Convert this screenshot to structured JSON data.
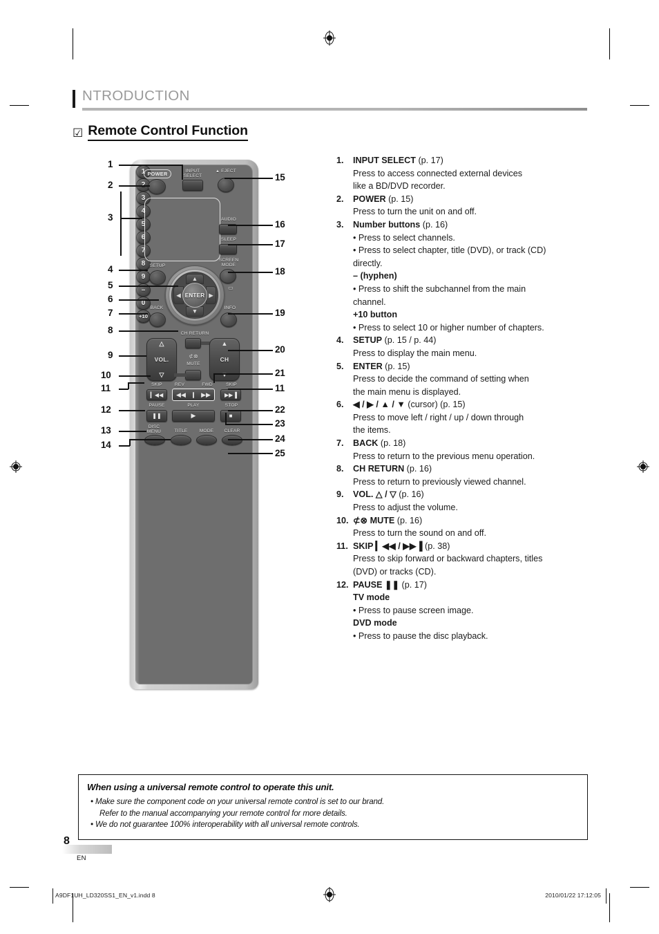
{
  "header": {
    "chapter": "NTRODUCTION",
    "section_title": "Remote Control Function",
    "checkbox_glyph": "☑"
  },
  "remote": {
    "labels": {
      "power": "POWER",
      "input_select_line1": "INPUT",
      "input_select_line2": "SELECT",
      "eject": "EJECT",
      "eject_glyph": "▲",
      "audio": "AUDIO",
      "sleep": "SLEEP",
      "screen_mode_line1": "SCREEN",
      "screen_mode_line2": "MODE",
      "setup": "SETUP",
      "enter": "ENTER",
      "back": "BACK",
      "info": "INFO",
      "ch_return": "CH RETURN",
      "vol": "VOL.",
      "mute": "MUTE",
      "mute_glyph": "⊄⊗",
      "ch": "CH",
      "skip_left": "SKIP",
      "skip_right": "SKIP",
      "rev": "REV",
      "fwd": "FWD",
      "play": "PLAY",
      "pause": "PAUSE",
      "stop": "STOP",
      "disc_menu_line1": "DISC",
      "disc_menu_line2": "MENU",
      "title": "TITLE",
      "mode": "MODE",
      "clear": "CLEAR"
    },
    "glyphs": {
      "up": "▲",
      "down": "▼",
      "left": "◀",
      "right": "▶",
      "vol_up": "△",
      "vol_down": "▽",
      "ch_up": "▲",
      "ch_down": "▼",
      "skip_prev": "▎◀◀",
      "skip_next": "▶▶▐",
      "rev": "◀◀",
      "fwd": "▶▶",
      "play": "▶",
      "pause": "❚❚",
      "stop": "■",
      "screen_mode_icon": "▭"
    },
    "keypad": [
      "1",
      "2",
      "3",
      "4",
      "5",
      "6",
      "7",
      "8",
      "9",
      "–",
      "0",
      "+10"
    ],
    "callouts_left": [
      "1",
      "2",
      "3",
      "4",
      "5",
      "6",
      "7",
      "8",
      "9",
      "10",
      "11",
      "12",
      "13",
      "14"
    ],
    "callouts_right": [
      "15",
      "16",
      "17",
      "18",
      "19",
      "20",
      "21",
      "11",
      "22",
      "23",
      "24",
      "25"
    ]
  },
  "functions": [
    {
      "num": "1.",
      "name": "INPUT SELECT",
      "page": "(p. 17)",
      "lines": [
        {
          "style": "plain",
          "text": "Press to access connected external devices"
        },
        {
          "style": "plain",
          "text": "like a BD/DVD recorder."
        }
      ]
    },
    {
      "num": "2.",
      "name": "POWER",
      "page": "(p. 15)",
      "lines": [
        {
          "style": "plain",
          "text": "Press to turn the unit on and off."
        }
      ]
    },
    {
      "num": "3.",
      "name": "Number buttons",
      "page": "(p. 16)",
      "lines": [
        {
          "style": "bullet",
          "text": "• Press to select channels."
        },
        {
          "style": "bullet",
          "text": "• Press to select chapter, title (DVD), or track (CD)"
        },
        {
          "style": "cont",
          "text": "directly."
        },
        {
          "style": "sub",
          "text": "– (hyphen)"
        },
        {
          "style": "bullet",
          "text": "• Press to shift the subchannel from the main"
        },
        {
          "style": "cont",
          "text": "channel."
        },
        {
          "style": "sub",
          "text": "+10 button"
        },
        {
          "style": "bullet",
          "text": "• Press to select 10 or higher number of chapters."
        }
      ]
    },
    {
      "num": "4.",
      "name": "SETUP",
      "page": "(p. 15 / p. 44)",
      "lines": [
        {
          "style": "plain",
          "text": "Press to display the main menu."
        }
      ]
    },
    {
      "num": "5.",
      "name": "ENTER",
      "page": "(p. 15)",
      "lines": [
        {
          "style": "plain",
          "text": "Press to decide the command of setting when"
        },
        {
          "style": "plain",
          "text": "the main menu is displayed."
        }
      ]
    },
    {
      "num": "6.",
      "name": "◀ / ▶ / ▲ / ▼",
      "page": "(cursor) (p. 15)",
      "lines": [
        {
          "style": "plain",
          "text": "Press to move left / right / up / down through"
        },
        {
          "style": "plain",
          "text": "the items."
        }
      ]
    },
    {
      "num": "7.",
      "name": "BACK",
      "page": "(p. 18)",
      "lines": [
        {
          "style": "plain",
          "text": "Press to return to the previous menu operation."
        }
      ]
    },
    {
      "num": "8.",
      "name": "CH RETURN",
      "page": "(p. 16)",
      "lines": [
        {
          "style": "plain",
          "text": "Press to return to previously viewed channel."
        }
      ]
    },
    {
      "num": "9.",
      "name": "VOL. △ / ▽",
      "page": "(p. 16)",
      "lines": [
        {
          "style": "plain",
          "text": "Press to adjust the volume."
        }
      ]
    },
    {
      "num": "10.",
      "name": "⊄⊗ MUTE",
      "page": "(p. 16)",
      "lines": [
        {
          "style": "plain",
          "text": "Press to turn the sound on and off."
        }
      ]
    },
    {
      "num": "11.",
      "name": "SKIP ▎◀◀ / ▶▶▐",
      "page": "(p. 38)",
      "lines": [
        {
          "style": "plain",
          "text": "Press to skip forward or backward chapters, titles"
        },
        {
          "style": "plain",
          "text": "(DVD) or tracks (CD)."
        }
      ]
    },
    {
      "num": "12.",
      "name": "PAUSE ❚❚",
      "page": "(p. 17)",
      "lines": [
        {
          "style": "sub",
          "text": "TV mode"
        },
        {
          "style": "bullet",
          "text": "• Press to pause screen image."
        },
        {
          "style": "sub",
          "text": "DVD mode"
        },
        {
          "style": "bullet",
          "text": "• Press to pause the disc playback."
        }
      ]
    }
  ],
  "note": {
    "title": "When using a universal remote control to operate this unit.",
    "lines": [
      {
        "style": "bullet",
        "text": "• Make sure the component code on your universal remote control is set to our brand."
      },
      {
        "style": "cont",
        "text": "Refer to the manual accompanying your remote control for more details."
      },
      {
        "style": "bullet",
        "text": "• We do not guarantee 100% interoperability with all universal remote controls."
      }
    ]
  },
  "footer": {
    "page_number": "8",
    "language": "EN",
    "file_name": "A9DF1UH_LD320SS1_EN_v1.indd   8",
    "timestamp": "2010/01/22   17:12:05"
  }
}
